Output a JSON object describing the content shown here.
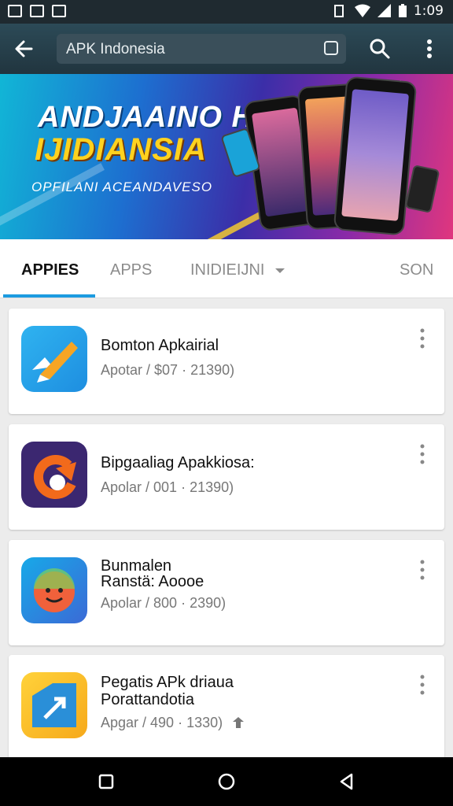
{
  "status_bar": {
    "time": "1:09"
  },
  "app_bar": {
    "search_value": "APK Indonesia"
  },
  "banner": {
    "title_line1": "ANDJAAINO H",
    "title_line2": "IJIDIANSIA",
    "subtitle": "OPFILANI ACEANDAVESO",
    "colors": {
      "title1": "#ffffff",
      "title2": "#ffd21f"
    }
  },
  "tabs": [
    {
      "label": "APPIES",
      "active": true
    },
    {
      "label": "APPS"
    },
    {
      "label": "INIDIEIJNI"
    },
    {
      "label": "SON"
    }
  ],
  "apps": [
    {
      "title_line1": "Bomton Apkairial",
      "title_line2": "",
      "meta": "Apotar / $07 · 21390)"
    },
    {
      "title_line1": "Bipgaaliag Apakkiosa:",
      "title_line2": "",
      "meta": "Apolar / 001 · 21390)"
    },
    {
      "title_line1": "Bunmalen",
      "title_line2": "Ranstä: Aoooe",
      "meta": "Apolar / 800 · 2390)"
    },
    {
      "title_line1": "Pegatis APk driaua",
      "title_line2": "Porattandotia",
      "meta": "Apgar / 490 · 1330)"
    }
  ],
  "theme": {
    "accent": "#1c9be0",
    "appbar": "#2c4a57"
  }
}
